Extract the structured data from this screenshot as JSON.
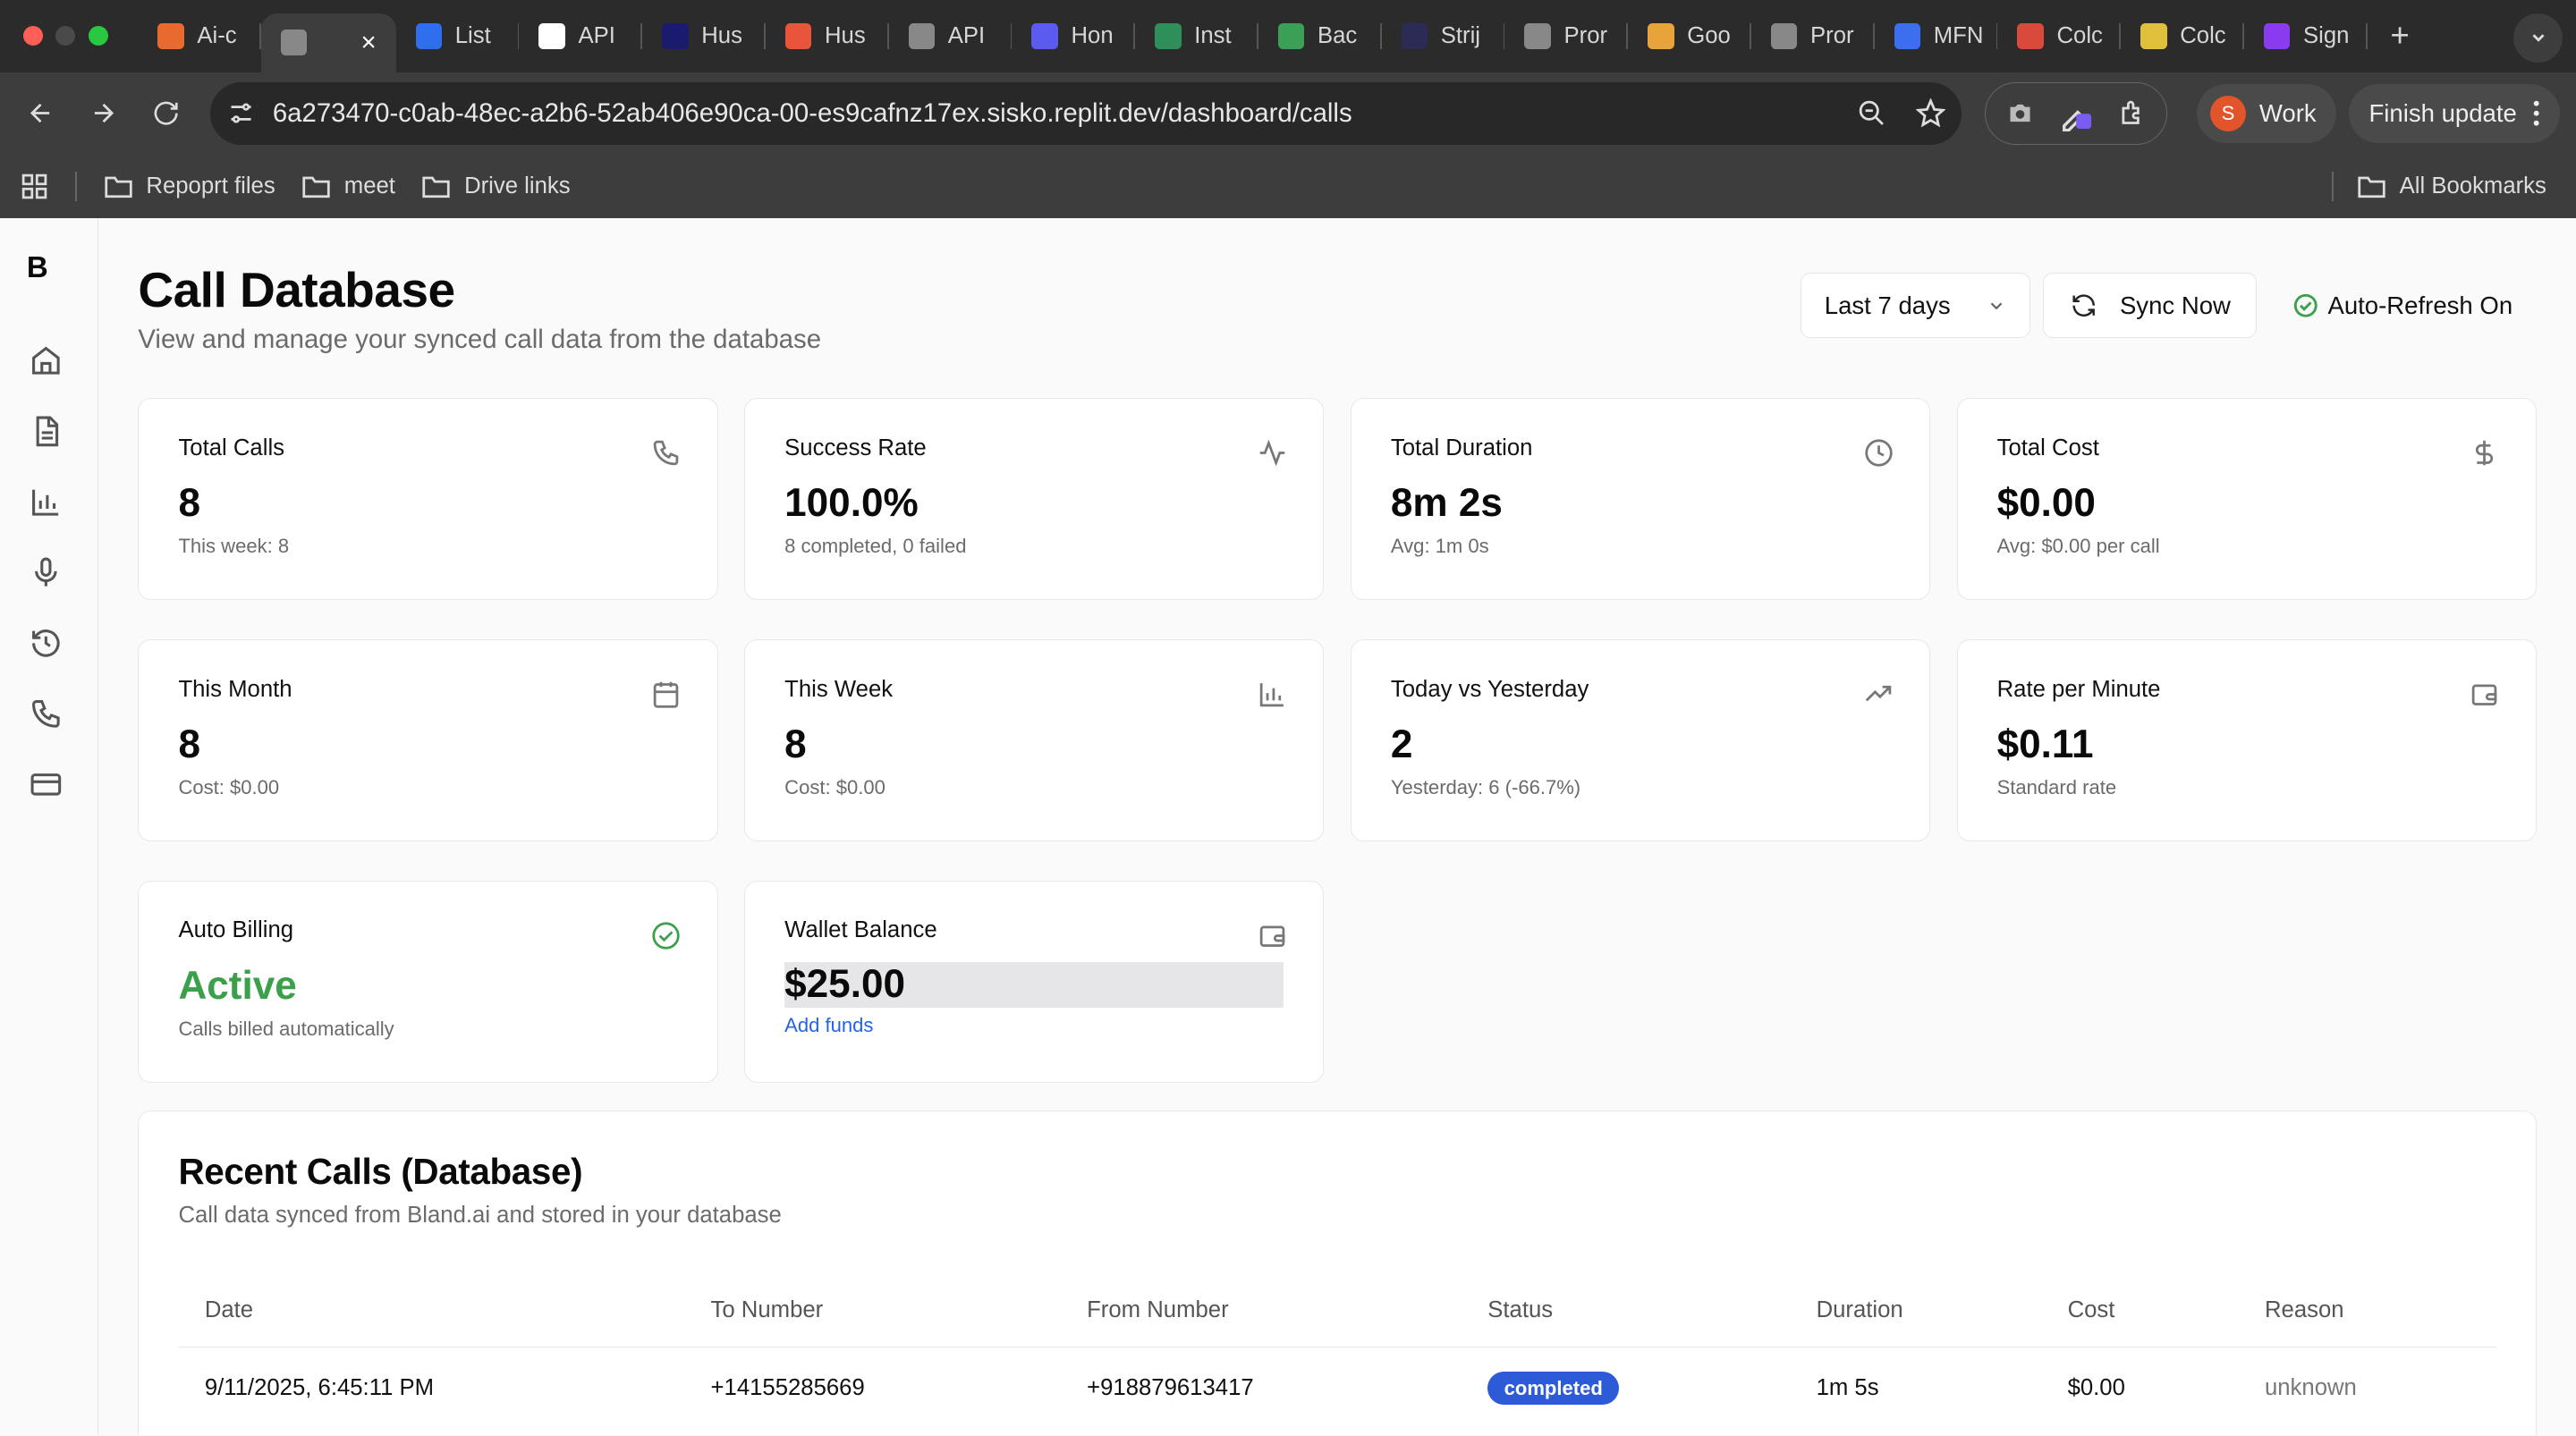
{
  "browser": {
    "tabs": [
      {
        "label": "Ai-c",
        "favicon_color": "#e96a2e"
      },
      {
        "label": "",
        "favicon_color": "#888888",
        "active": true
      },
      {
        "label": "List",
        "favicon_color": "#2f6fed"
      },
      {
        "label": "API",
        "favicon_color": "#ffffff"
      },
      {
        "label": "Hus",
        "favicon_color": "#1a1a6e"
      },
      {
        "label": "Hus",
        "favicon_color": "#e8553b"
      },
      {
        "label": "API",
        "favicon_color": "#888888"
      },
      {
        "label": "Hon",
        "favicon_color": "#5b5bf0"
      },
      {
        "label": "Inst",
        "favicon_color": "#2f8f5a"
      },
      {
        "label": "Bac",
        "favicon_color": "#3ba055"
      },
      {
        "label": "Strij",
        "favicon_color": "#2b2b55"
      },
      {
        "label": "Pror",
        "favicon_color": "#888888"
      },
      {
        "label": "Goo",
        "favicon_color": "#e8a33b"
      },
      {
        "label": "Pror",
        "favicon_color": "#888888"
      },
      {
        "label": "MFN",
        "favicon_color": "#3b6ff0"
      },
      {
        "label": "Colc",
        "favicon_color": "#d94a3b"
      },
      {
        "label": "Colc",
        "favicon_color": "#e0c03b"
      },
      {
        "label": "Sign",
        "favicon_color": "#8a3bf0"
      }
    ],
    "url": "6a273470-c0ab-48ec-a2b6-52ab406e90ca-00-es9cafnz17ex.sisko.replit.dev/dashboard/calls",
    "profile_initial": "S",
    "profile_name": "Work",
    "finish_update": "Finish update",
    "bookmarks": [
      "Repoprt files",
      "meet",
      "Drive links"
    ],
    "all_bookmarks": "All Bookmarks"
  },
  "sidebar": {
    "brand": "B",
    "items": [
      "home-icon",
      "document-icon",
      "bar-chart-icon",
      "microphone-icon",
      "history-icon",
      "phone-icon",
      "credit-card-icon"
    ]
  },
  "header": {
    "title": "Call Database",
    "subtitle": "View and manage your synced call data from the database",
    "range": "Last 7 days",
    "sync": "Sync Now",
    "auto_refresh": "Auto-Refresh On"
  },
  "stats": [
    {
      "label": "Total Calls",
      "value": "8",
      "sub": "This week: 8",
      "icon": "phone-icon"
    },
    {
      "label": "Success Rate",
      "value": "100.0%",
      "sub": "8 completed, 0 failed",
      "icon": "activity-icon"
    },
    {
      "label": "Total Duration",
      "value": "8m 2s",
      "sub": "Avg: 1m 0s",
      "icon": "clock-icon"
    },
    {
      "label": "Total Cost",
      "value": "$0.00",
      "sub": "Avg: $0.00 per call",
      "icon": "dollar-icon"
    },
    {
      "label": "This Month",
      "value": "8",
      "sub": "Cost: $0.00",
      "icon": "calendar-icon"
    },
    {
      "label": "This Week",
      "value": "8",
      "sub": "Cost: $0.00",
      "icon": "bar-chart-icon"
    },
    {
      "label": "Today vs Yesterday",
      "value": "2",
      "sub": "Yesterday: 6 (-66.7%)",
      "icon": "trending-up-icon"
    },
    {
      "label": "Rate per Minute",
      "value": "$0.11",
      "sub": "Standard rate",
      "icon": "wallet-icon"
    },
    {
      "label": "Auto Billing",
      "value": "Active",
      "sub": "Calls billed automatically",
      "icon": "check-circle-icon"
    },
    {
      "label": "Wallet Balance",
      "value": "$25.00",
      "sub": "Add funds",
      "icon": "wallet-icon"
    }
  ],
  "recent": {
    "title": "Recent Calls (Database)",
    "subtitle": "Call data synced from Bland.ai and stored in your database",
    "columns": [
      "Date",
      "To Number",
      "From Number",
      "Status",
      "Duration",
      "Cost",
      "Reason"
    ],
    "rows": [
      {
        "date": "9/11/2025, 6:45:11 PM",
        "to": "+14155285669",
        "from": "+918879613417",
        "status": "completed",
        "duration": "1m 5s",
        "cost": "$0.00",
        "reason": "unknown"
      }
    ]
  }
}
